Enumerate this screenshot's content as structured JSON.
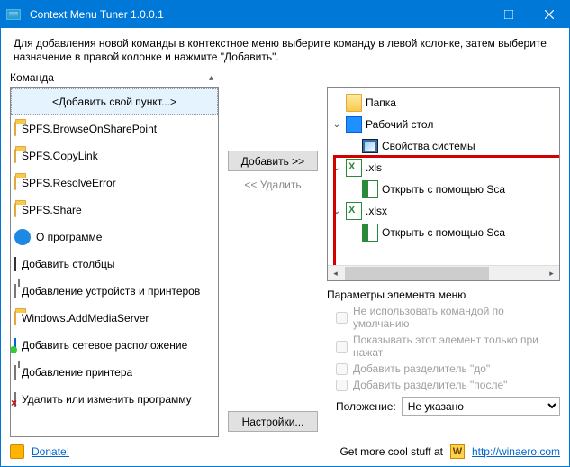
{
  "window": {
    "title": "Context Menu Tuner 1.0.0.1"
  },
  "instruction": "Для добавления новой команды в контекстное меню выберите команду в левой колонке, затем выберите назначение в правой колонке и нажмите \"Добавить\".",
  "left": {
    "header": "Команда",
    "items": [
      {
        "label": "<Добавить свой пункт...>",
        "icon": "none",
        "selected": true
      },
      {
        "label": "SPFS.BrowseOnSharePoint",
        "icon": "folder"
      },
      {
        "label": "SPFS.CopyLink",
        "icon": "folder"
      },
      {
        "label": "SPFS.ResolveError",
        "icon": "folder"
      },
      {
        "label": "SPFS.Share",
        "icon": "folder"
      },
      {
        "label": "О программе",
        "icon": "info"
      },
      {
        "label": "Добавить столбцы",
        "icon": "columns"
      },
      {
        "label": "Добавление устройств и принтеров",
        "icon": "printer"
      },
      {
        "label": "Windows.AddMediaServer",
        "icon": "folder"
      },
      {
        "label": "Добавить сетевое расположение",
        "icon": "net"
      },
      {
        "label": "Добавление принтера",
        "icon": "printer"
      },
      {
        "label": "Удалить или изменить программу",
        "icon": "del"
      }
    ]
  },
  "mid": {
    "add": "Добавить >> ",
    "remove": "<<  Удалить",
    "settings": "Настройки..."
  },
  "tree": {
    "nodes": [
      {
        "label": "Папка",
        "icon": "folderbig",
        "expanded": false,
        "children": []
      },
      {
        "label": "Рабочий стол",
        "icon": "desktop",
        "expanded": true,
        "children": [
          {
            "label": "Свойства системы",
            "icon": "monitor",
            "children": []
          }
        ]
      },
      {
        "label": ".xls",
        "icon": "excel",
        "expanded": true,
        "children": [
          {
            "label": "Открыть с помощью Sca",
            "icon": "scalc",
            "children": []
          }
        ]
      },
      {
        "label": ".xlsx",
        "icon": "excel",
        "expanded": true,
        "children": [
          {
            "label": "Открыть с помощью Sca",
            "icon": "scalc",
            "children": []
          }
        ]
      }
    ]
  },
  "params": {
    "header": "Параметры элемента меню",
    "opt1": "Не использовать командой по умолчанию",
    "opt2": "Показывать этот элемент только при нажат",
    "opt3": "Добавить разделитель \"до\"",
    "opt4": "Добавить разделитель \"после\"",
    "pos_label": "Положение:",
    "pos_value": "Не указано"
  },
  "footer": {
    "donate": "Donate!",
    "promo": "Get more cool stuff at",
    "url": "http://winaero.com",
    "w": "W"
  }
}
